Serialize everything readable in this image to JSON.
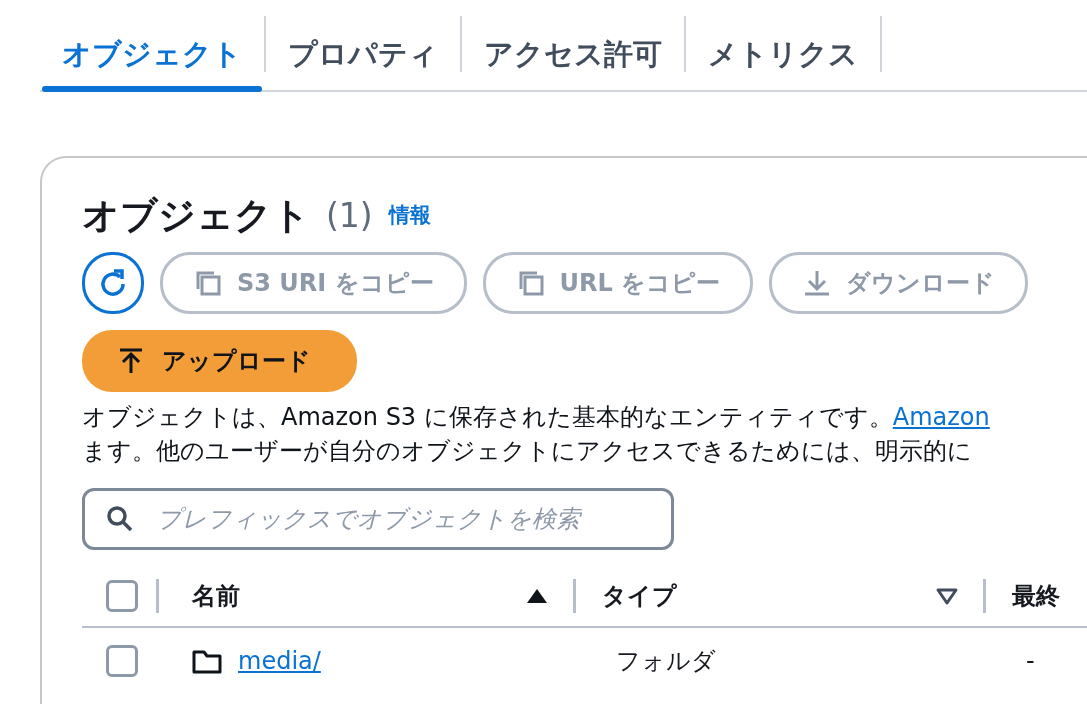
{
  "tabs": [
    {
      "label": "オブジェクト",
      "selected": true
    },
    {
      "label": "プロパティ",
      "selected": false
    },
    {
      "label": "アクセス許可",
      "selected": false
    },
    {
      "label": "メトリクス",
      "selected": false
    }
  ],
  "panel": {
    "title": "オブジェクト",
    "count": "(1)",
    "info_link": "情報",
    "actions": [
      {
        "kind": "refresh",
        "disabled": false
      },
      {
        "kind": "copy",
        "label": "S3 URI をコピー",
        "disabled": true
      },
      {
        "kind": "copy",
        "label": "URL をコピー",
        "disabled": true
      },
      {
        "kind": "download",
        "label": "ダウンロード",
        "disabled": true
      }
    ],
    "upload_button": "アップロード",
    "description": {
      "line_1": "オブジェクトは、Amazon S3 に保存された基本的なエンティティです。",
      "link": "Amazon",
      "line_2": "ます。他のユーザーが自分のオブジェクトにアクセスできるためには、明示的に"
    },
    "search": {
      "placeholder": "プレフィックスでオブジェクトを検索"
    },
    "table": {
      "header_checked": false,
      "columns": [
        {
          "label": "名前",
          "sorted": true
        },
        {
          "label": "タイプ",
          "sorted": false
        },
        {
          "label": "最終"
        }
      ],
      "rows": [
        {
          "checked": false,
          "name": "media/",
          "type": "フォルダ",
          "column_3": "-"
        }
      ]
    }
  }
}
